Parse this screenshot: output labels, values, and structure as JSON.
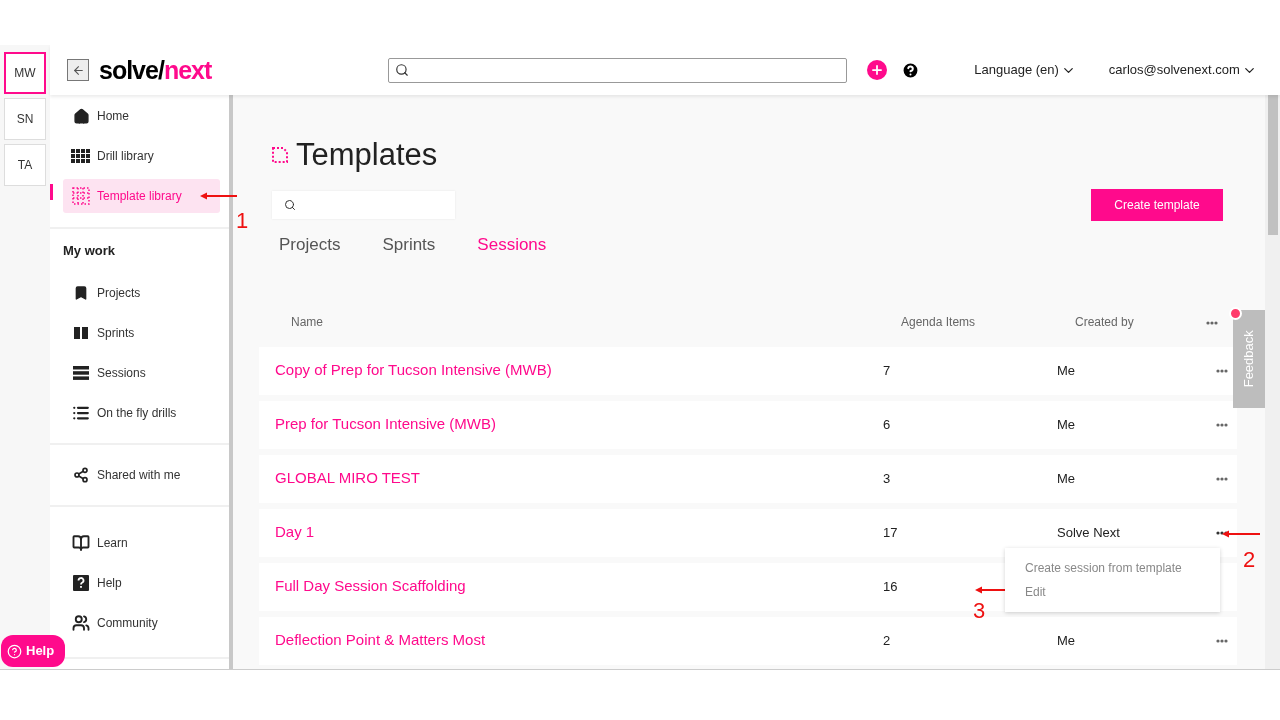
{
  "workspaces": [
    {
      "label": "MW",
      "selected": true
    },
    {
      "label": "SN",
      "selected": false
    },
    {
      "label": "TA",
      "selected": false
    }
  ],
  "header": {
    "logo_main": "solve/",
    "logo_accent": "next",
    "language": "Language (en)",
    "user": "carlos@solvenext.com"
  },
  "sidebar": {
    "sections": [
      {
        "items": [
          {
            "label": "Home",
            "selected": false
          },
          {
            "label": "Drill library",
            "selected": false
          },
          {
            "label": "Template library",
            "selected": true
          }
        ]
      },
      {
        "heading": "My work",
        "items": [
          {
            "label": "Projects",
            "selected": false
          },
          {
            "label": "Sprints",
            "selected": false
          },
          {
            "label": "Sessions",
            "selected": false
          },
          {
            "label": "On the fly drills",
            "selected": false
          }
        ]
      },
      {
        "items": [
          {
            "label": "Shared with me",
            "selected": false
          }
        ]
      },
      {
        "items": [
          {
            "label": "Learn",
            "selected": false
          },
          {
            "label": "Help",
            "selected": false
          },
          {
            "label": "Community",
            "selected": false
          }
        ]
      }
    ]
  },
  "help_button": "Help",
  "page": {
    "title": "Templates",
    "create_button": "Create template",
    "tabs": [
      {
        "label": "Projects",
        "selected": false
      },
      {
        "label": "Sprints",
        "selected": false
      },
      {
        "label": "Sessions",
        "selected": true
      }
    ],
    "columns": [
      "Name",
      "Agenda Items",
      "Created by"
    ],
    "rows": [
      {
        "name": "Copy of Prep for Tucson Intensive (MWB)",
        "agenda_items": "7",
        "created_by": "Me",
        "menu_open": false
      },
      {
        "name": "Prep for Tucson Intensive (MWB)",
        "agenda_items": "6",
        "created_by": "Me",
        "menu_open": false
      },
      {
        "name": "GLOBAL MIRO TEST",
        "agenda_items": "3",
        "created_by": "Me",
        "menu_open": false
      },
      {
        "name": "Day 1",
        "agenda_items": "17",
        "created_by": "Solve Next",
        "menu_open": true
      },
      {
        "name": "Full Day Session Scaffolding",
        "agenda_items": "16"
      },
      {
        "name": "Deflection Point & Matters Most",
        "agenda_items": "2",
        "created_by": "Me",
        "menu_open": false
      }
    ],
    "row_menu": [
      "Create session from template",
      "Edit"
    ]
  },
  "feedback": "Feedback",
  "annotations": [
    "1",
    "2",
    "3"
  ]
}
